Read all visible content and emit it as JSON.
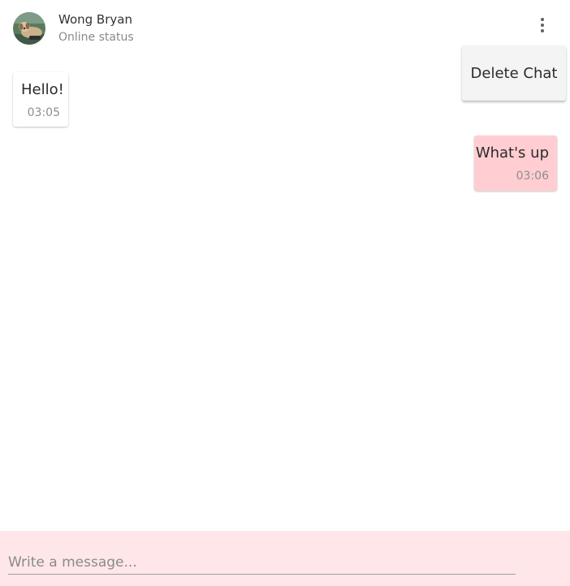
{
  "header": {
    "contact_name": "Wong Bryan",
    "contact_status": "Online status",
    "avatar_icon": "dog-avatar",
    "menu_icon": "more-vertical-icon"
  },
  "menu": {
    "items": [
      {
        "label": "Delete Chat"
      }
    ]
  },
  "messages": [
    {
      "direction": "incoming",
      "text": "Hello!",
      "time": "03:05"
    },
    {
      "direction": "outgoing",
      "text": "What's up",
      "time": "03:06"
    }
  ],
  "composer": {
    "placeholder": "Write a message...",
    "value": ""
  },
  "colors": {
    "outgoing_bubble": "#ffcdd2",
    "composer_background": "#ffe7e9",
    "menu_background": "#f4f4f4"
  }
}
